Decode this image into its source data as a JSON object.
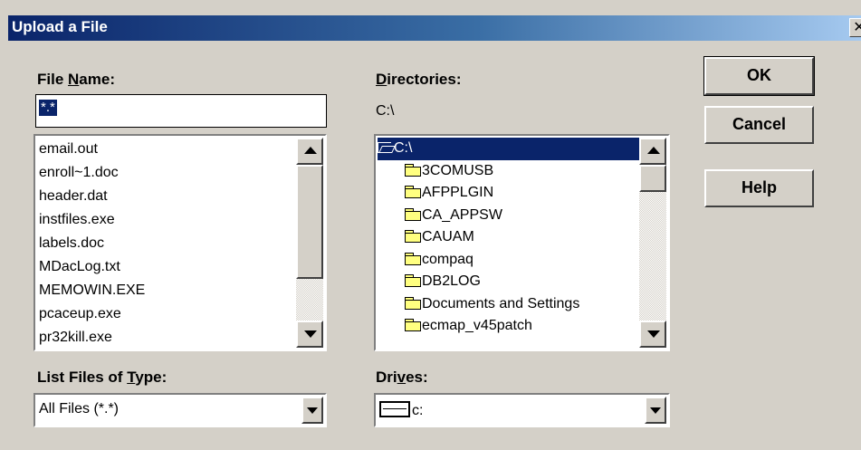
{
  "window": {
    "title": "Upload a File",
    "close_glyph": "✕"
  },
  "file_name": {
    "label_prefix": "File ",
    "label_mnemonic": "N",
    "label_suffix": "ame:",
    "value": "*.*"
  },
  "files": [
    "email.out",
    "enroll~1.doc",
    "header.dat",
    "instfiles.exe",
    "labels.doc",
    "MDacLog.txt",
    "MEMOWIN.EXE",
    "pcaceup.exe",
    "pr32kill.exe"
  ],
  "directories": {
    "label_mnemonic": "D",
    "label_suffix": "irectories:",
    "current_path": "C:\\",
    "root": "C:\\",
    "items": [
      "3COMUSB",
      "AFPPLGIN",
      "CA_APPSW",
      "CAUAM",
      "compaq",
      "DB2LOG",
      "Documents and Settings",
      "ecmap_v45patch"
    ]
  },
  "file_type": {
    "label_prefix": "List Files of ",
    "label_mnemonic": "T",
    "label_suffix": "ype:",
    "value": "All Files (*.*)"
  },
  "drives": {
    "label_prefix": "Dri",
    "label_mnemonic": "v",
    "label_suffix": "es:",
    "value": "c:"
  },
  "buttons": {
    "ok": "OK",
    "cancel": "Cancel",
    "help": "Help"
  },
  "icons": {
    "folder": "folder-icon",
    "open_folder": "open-folder-icon",
    "drive": "drive-icon"
  }
}
